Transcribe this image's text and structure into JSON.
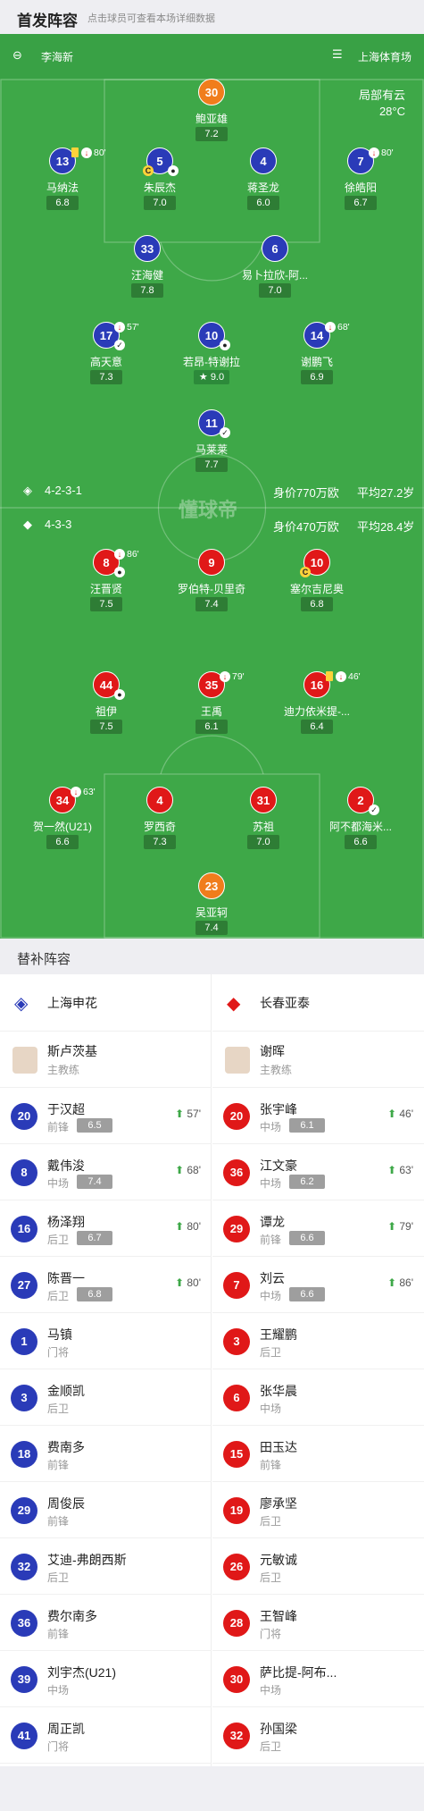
{
  "header": {
    "title": "首发阵容",
    "subtitle": "点击球员可查看本场详细数据"
  },
  "pitch": {
    "referee": "李海新",
    "venue": "上海体育场",
    "weather": "局部有云",
    "temp": "28°C",
    "watermark": "懂球帝"
  },
  "home": {
    "formation": "4-2-3-1",
    "value": "身价770万欧",
    "age": "平均27.2岁",
    "players": [
      {
        "num": "30",
        "name": "鲍亚雄",
        "rating": "7.2",
        "color": "g"
      },
      {
        "num": "13",
        "name": "马纳法",
        "rating": "6.8",
        "sub": "80'"
      },
      {
        "num": "5",
        "name": "朱辰杰",
        "rating": "7.0"
      },
      {
        "num": "4",
        "name": "蒋圣龙",
        "rating": "6.0"
      },
      {
        "num": "7",
        "name": "徐皓阳",
        "rating": "6.7",
        "sub": "80'"
      },
      {
        "num": "33",
        "name": "汪海健",
        "rating": "7.8"
      },
      {
        "num": "6",
        "name": "易卜拉欣-阿...",
        "rating": "7.0"
      },
      {
        "num": "17",
        "name": "高天意",
        "rating": "7.3",
        "sub": "57'"
      },
      {
        "num": "10",
        "name": "若昂-特谢拉",
        "rating": "9.0"
      },
      {
        "num": "14",
        "name": "谢鹏飞",
        "rating": "6.9",
        "sub": "68'"
      },
      {
        "num": "11",
        "name": "马莱莱",
        "rating": "7.7"
      }
    ]
  },
  "away": {
    "formation": "4-3-3",
    "value": "身价470万欧",
    "age": "平均28.4岁",
    "players": [
      {
        "num": "8",
        "name": "汪晋贤",
        "rating": "7.5",
        "sub": "86'"
      },
      {
        "num": "9",
        "name": "罗伯特-贝里奇",
        "rating": "7.4"
      },
      {
        "num": "10",
        "name": "塞尔吉尼奥",
        "rating": "6.8"
      },
      {
        "num": "44",
        "name": "祖伊",
        "rating": "7.5"
      },
      {
        "num": "35",
        "name": "王禹",
        "rating": "6.1",
        "sub": "79'"
      },
      {
        "num": "16",
        "name": "迪力依米提-...",
        "rating": "6.4",
        "sub": "46'"
      },
      {
        "num": "34",
        "name": "贺一然(U21)",
        "rating": "6.6",
        "sub": "63'"
      },
      {
        "num": "4",
        "name": "罗西奇",
        "rating": "7.3"
      },
      {
        "num": "31",
        "name": "苏祖",
        "rating": "7.0"
      },
      {
        "num": "2",
        "name": "阿不都海米...",
        "rating": "6.6"
      },
      {
        "num": "23",
        "name": "吴亚轲",
        "rating": "7.4",
        "color": "g"
      }
    ]
  },
  "subs": {
    "title": "替补阵容",
    "home": {
      "team": "上海申花",
      "coach": "斯卢茨基",
      "coach_role": "主教练",
      "list": [
        {
          "num": "20",
          "name": "于汉超",
          "pos": "前锋",
          "rating": "6.5",
          "min": "57'"
        },
        {
          "num": "8",
          "name": "戴伟浚",
          "pos": "中场",
          "rating": "7.4",
          "min": "68'"
        },
        {
          "num": "16",
          "name": "杨泽翔",
          "pos": "后卫",
          "rating": "6.7",
          "min": "80'"
        },
        {
          "num": "27",
          "name": "陈晋一",
          "pos": "后卫",
          "rating": "6.8",
          "min": "80'"
        },
        {
          "num": "1",
          "name": "马镇",
          "pos": "门将"
        },
        {
          "num": "3",
          "name": "金顺凯",
          "pos": "后卫"
        },
        {
          "num": "18",
          "name": "费南多",
          "pos": "前锋"
        },
        {
          "num": "29",
          "name": "周俊辰",
          "pos": "前锋"
        },
        {
          "num": "32",
          "name": "艾迪-弗朗西斯",
          "pos": "后卫"
        },
        {
          "num": "36",
          "name": "费尔南多",
          "pos": "前锋"
        },
        {
          "num": "39",
          "name": "刘宇杰(U21)",
          "pos": "中场"
        },
        {
          "num": "41",
          "name": "周正凯",
          "pos": "门将"
        }
      ]
    },
    "away": {
      "team": "长春亚泰",
      "coach": "谢晖",
      "coach_role": "主教练",
      "list": [
        {
          "num": "20",
          "name": "张宇峰",
          "pos": "中场",
          "rating": "6.1",
          "min": "46'"
        },
        {
          "num": "36",
          "name": "江文豪",
          "pos": "中场",
          "rating": "6.2",
          "min": "63'"
        },
        {
          "num": "29",
          "name": "谭龙",
          "pos": "前锋",
          "rating": "6.6",
          "min": "79'"
        },
        {
          "num": "7",
          "name": "刘云",
          "pos": "中场",
          "rating": "6.6",
          "min": "86'"
        },
        {
          "num": "3",
          "name": "王耀鹏",
          "pos": "后卫"
        },
        {
          "num": "6",
          "name": "张华晨",
          "pos": "中场"
        },
        {
          "num": "15",
          "name": "田玉达",
          "pos": "前锋"
        },
        {
          "num": "19",
          "name": "廖承坚",
          "pos": "后卫"
        },
        {
          "num": "26",
          "name": "元敏诚",
          "pos": "后卫"
        },
        {
          "num": "28",
          "name": "王智峰",
          "pos": "门将"
        },
        {
          "num": "30",
          "name": "萨比提-阿布...",
          "pos": "中场"
        },
        {
          "num": "32",
          "name": "孙国梁",
          "pos": "后卫"
        }
      ]
    }
  }
}
